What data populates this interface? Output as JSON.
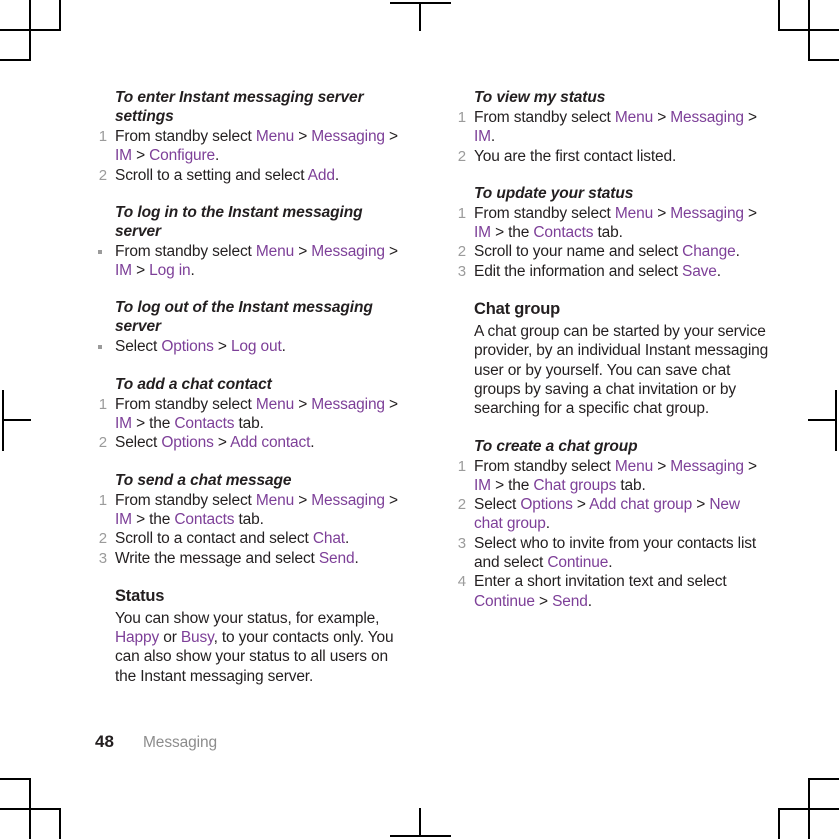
{
  "document": {
    "page_number": "48",
    "chapter": "Messaging",
    "link_color": "#7d3f98",
    "text_color": "#231f20",
    "marker_color": "#9b9b9b"
  },
  "left_column": [
    {
      "type": "procedure",
      "heading": "To enter Instant messaging server settings",
      "list_style": "numbered",
      "steps": [
        {
          "marker": "1",
          "parts": [
            {
              "t": "From standby select ",
              "ui": false
            },
            {
              "t": "Menu",
              "ui": true
            },
            {
              "t": " > ",
              "ui": false
            },
            {
              "t": "Messaging",
              "ui": true
            },
            {
              "t": " > ",
              "ui": false
            },
            {
              "t": "IM",
              "ui": true
            },
            {
              "t": " > ",
              "ui": false
            },
            {
              "t": "Configure",
              "ui": true
            },
            {
              "t": ".",
              "ui": false
            }
          ]
        },
        {
          "marker": "2",
          "parts": [
            {
              "t": "Scroll to a setting and select ",
              "ui": false
            },
            {
              "t": "Add",
              "ui": true
            },
            {
              "t": ".",
              "ui": false
            }
          ]
        }
      ]
    },
    {
      "type": "procedure",
      "heading": "To log in to the Instant messaging server",
      "list_style": "bullet",
      "steps": [
        {
          "marker": "•",
          "parts": [
            {
              "t": "From standby select ",
              "ui": false
            },
            {
              "t": "Menu",
              "ui": true
            },
            {
              "t": " > ",
              "ui": false
            },
            {
              "t": "Messaging",
              "ui": true
            },
            {
              "t": " > ",
              "ui": false
            },
            {
              "t": "IM",
              "ui": true
            },
            {
              "t": " > ",
              "ui": false
            },
            {
              "t": "Log in",
              "ui": true
            },
            {
              "t": ".",
              "ui": false
            }
          ]
        }
      ]
    },
    {
      "type": "procedure",
      "heading": "To log out of the Instant messaging server",
      "list_style": "bullet",
      "steps": [
        {
          "marker": "•",
          "parts": [
            {
              "t": "Select ",
              "ui": false
            },
            {
              "t": "Options",
              "ui": true
            },
            {
              "t": " > ",
              "ui": false
            },
            {
              "t": "Log out",
              "ui": true
            },
            {
              "t": ".",
              "ui": false
            }
          ]
        }
      ]
    },
    {
      "type": "procedure",
      "heading": "To add a chat contact",
      "list_style": "numbered",
      "steps": [
        {
          "marker": "1",
          "parts": [
            {
              "t": "From standby select ",
              "ui": false
            },
            {
              "t": "Menu",
              "ui": true
            },
            {
              "t": " > ",
              "ui": false
            },
            {
              "t": "Messaging",
              "ui": true
            },
            {
              "t": " > ",
              "ui": false
            },
            {
              "t": "IM",
              "ui": true
            },
            {
              "t": " > the ",
              "ui": false
            },
            {
              "t": "Contacts",
              "ui": true
            },
            {
              "t": " tab.",
              "ui": false
            }
          ]
        },
        {
          "marker": "2",
          "parts": [
            {
              "t": "Select ",
              "ui": false
            },
            {
              "t": "Options",
              "ui": true
            },
            {
              "t": " > ",
              "ui": false
            },
            {
              "t": "Add contact",
              "ui": true
            },
            {
              "t": ".",
              "ui": false
            }
          ]
        }
      ]
    },
    {
      "type": "procedure",
      "heading": "To send a chat message",
      "list_style": "numbered",
      "steps": [
        {
          "marker": "1",
          "parts": [
            {
              "t": "From standby select ",
              "ui": false
            },
            {
              "t": "Menu",
              "ui": true
            },
            {
              "t": " > ",
              "ui": false
            },
            {
              "t": "Messaging",
              "ui": true
            },
            {
              "t": " > ",
              "ui": false
            },
            {
              "t": "IM",
              "ui": true
            },
            {
              "t": " > the ",
              "ui": false
            },
            {
              "t": "Contacts",
              "ui": true
            },
            {
              "t": " tab.",
              "ui": false
            }
          ]
        },
        {
          "marker": "2",
          "parts": [
            {
              "t": "Scroll to a contact and select ",
              "ui": false
            },
            {
              "t": "Chat",
              "ui": true
            },
            {
              "t": ".",
              "ui": false
            }
          ]
        },
        {
          "marker": "3",
          "parts": [
            {
              "t": "Write the message and select ",
              "ui": false
            },
            {
              "t": "Send",
              "ui": true
            },
            {
              "t": ".",
              "ui": false
            }
          ]
        }
      ]
    },
    {
      "type": "section",
      "heading": "Status",
      "paragraph": [
        {
          "t": "You can show your status, for example, ",
          "ui": false
        },
        {
          "t": "Happy",
          "ui": true
        },
        {
          "t": " or ",
          "ui": false
        },
        {
          "t": "Busy",
          "ui": true
        },
        {
          "t": ", to your contacts only. You can also show your status to all users on the Instant messaging server.",
          "ui": false
        }
      ]
    }
  ],
  "right_column": [
    {
      "type": "procedure",
      "heading": "To view my status",
      "list_style": "numbered",
      "steps": [
        {
          "marker": "1",
          "parts": [
            {
              "t": "From standby select ",
              "ui": false
            },
            {
              "t": "Menu",
              "ui": true
            },
            {
              "t": " > ",
              "ui": false
            },
            {
              "t": "Messaging",
              "ui": true
            },
            {
              "t": " > ",
              "ui": false
            },
            {
              "t": "IM",
              "ui": true
            },
            {
              "t": ".",
              "ui": false
            }
          ]
        },
        {
          "marker": "2",
          "parts": [
            {
              "t": "You are the first contact listed.",
              "ui": false
            }
          ]
        }
      ]
    },
    {
      "type": "procedure",
      "heading": "To update your status",
      "list_style": "numbered",
      "steps": [
        {
          "marker": "1",
          "parts": [
            {
              "t": "From standby select ",
              "ui": false
            },
            {
              "t": "Menu",
              "ui": true
            },
            {
              "t": " > ",
              "ui": false
            },
            {
              "t": "Messaging",
              "ui": true
            },
            {
              "t": " > ",
              "ui": false
            },
            {
              "t": "IM",
              "ui": true
            },
            {
              "t": " > the ",
              "ui": false
            },
            {
              "t": "Contacts",
              "ui": true
            },
            {
              "t": " tab.",
              "ui": false
            }
          ]
        },
        {
          "marker": "2",
          "parts": [
            {
              "t": "Scroll to your name and select ",
              "ui": false
            },
            {
              "t": "Change",
              "ui": true
            },
            {
              "t": ".",
              "ui": false
            }
          ]
        },
        {
          "marker": "3",
          "parts": [
            {
              "t": "Edit the information and select ",
              "ui": false
            },
            {
              "t": "Save",
              "ui": true
            },
            {
              "t": ".",
              "ui": false
            }
          ]
        }
      ]
    },
    {
      "type": "section",
      "heading": "Chat group",
      "paragraph": [
        {
          "t": "A chat group can be started by your service provider, by an individual Instant messaging user or by yourself. You can save chat groups by saving a chat invitation or by searching for a specific chat group.",
          "ui": false
        }
      ]
    },
    {
      "type": "procedure",
      "heading": "To create a chat group",
      "list_style": "numbered",
      "steps": [
        {
          "marker": "1",
          "parts": [
            {
              "t": "From standby select ",
              "ui": false
            },
            {
              "t": "Menu",
              "ui": true
            },
            {
              "t": " > ",
              "ui": false
            },
            {
              "t": "Messaging",
              "ui": true
            },
            {
              "t": " > ",
              "ui": false
            },
            {
              "t": "IM",
              "ui": true
            },
            {
              "t": " > the ",
              "ui": false
            },
            {
              "t": "Chat groups",
              "ui": true
            },
            {
              "t": " tab.",
              "ui": false
            }
          ]
        },
        {
          "marker": "2",
          "parts": [
            {
              "t": "Select ",
              "ui": false
            },
            {
              "t": "Options",
              "ui": true
            },
            {
              "t": " > ",
              "ui": false
            },
            {
              "t": "Add chat group",
              "ui": true
            },
            {
              "t": " > ",
              "ui": false
            },
            {
              "t": "New chat group",
              "ui": true
            },
            {
              "t": ".",
              "ui": false
            }
          ]
        },
        {
          "marker": "3",
          "parts": [
            {
              "t": "Select who to invite from your contacts list and select ",
              "ui": false
            },
            {
              "t": "Continue",
              "ui": true
            },
            {
              "t": ".",
              "ui": false
            }
          ]
        },
        {
          "marker": "4",
          "parts": [
            {
              "t": "Enter a short invitation text and select ",
              "ui": false
            },
            {
              "t": "Continue",
              "ui": true
            },
            {
              "t": " > ",
              "ui": false
            },
            {
              "t": "Send",
              "ui": true
            },
            {
              "t": ".",
              "ui": false
            }
          ]
        }
      ]
    }
  ]
}
